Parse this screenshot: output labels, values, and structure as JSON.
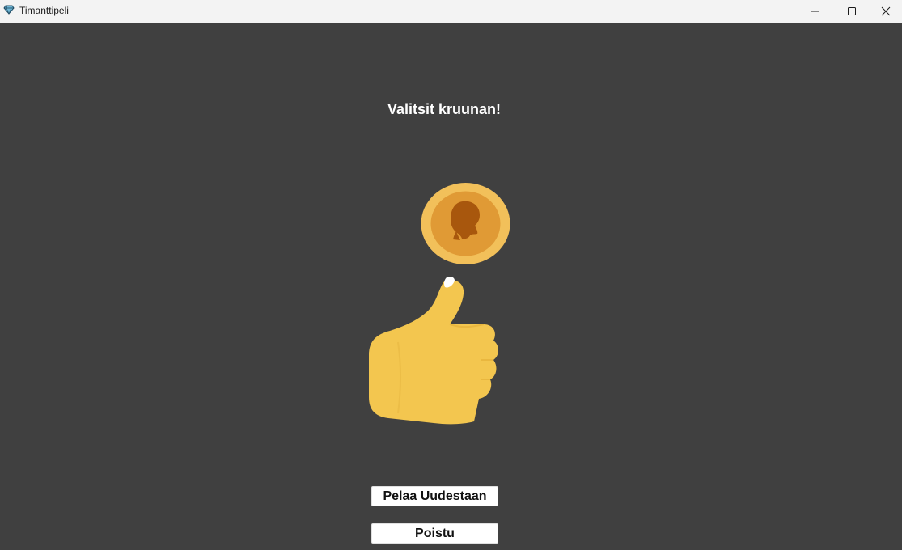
{
  "window": {
    "title": "Timanttipeli",
    "icon": "diamond-icon",
    "controls": [
      "minimize-icon",
      "maximize-icon",
      "close-icon"
    ]
  },
  "main": {
    "result_text": "Valitsit kruunan!",
    "coin_icon": "coin-head-icon",
    "reaction_icon": "thumbs-up-icon"
  },
  "buttons": {
    "play_again": "Pelaa Uudestaan",
    "quit": "Poistu"
  },
  "colors": {
    "background": "#404040",
    "titlebar": "#f3f3f3",
    "coin_outer": "#f2c05a",
    "coin_inner": "#e09a35",
    "coin_profile": "#a8570d",
    "thumb": "#f3c64f",
    "text": "#ffffff"
  }
}
